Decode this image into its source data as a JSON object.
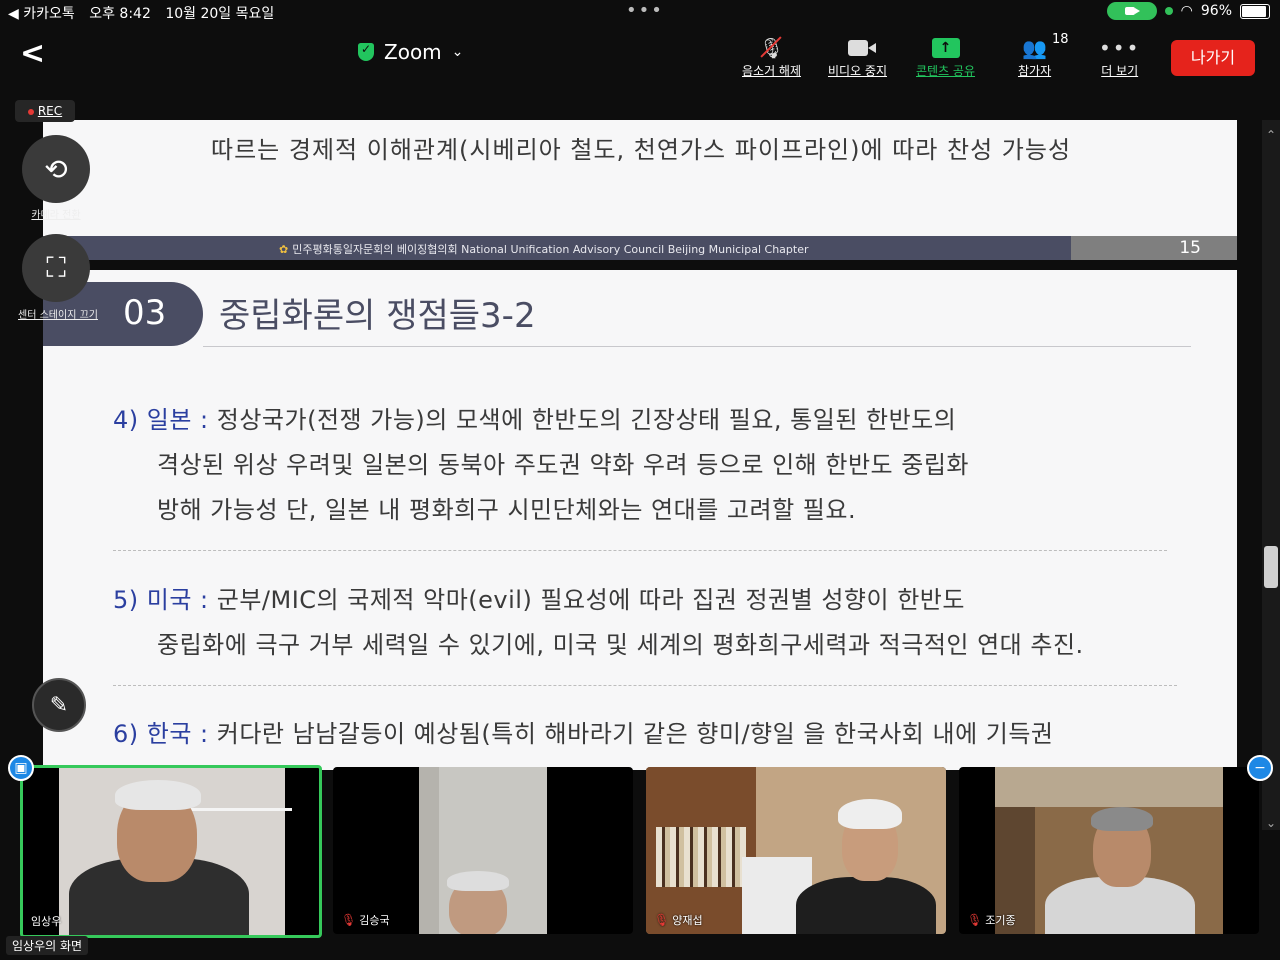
{
  "status": {
    "app": "◀ 카카오톡",
    "time": "오후 8:42",
    "date": "10월 20일 목요일",
    "battery": "96%"
  },
  "topbar": {
    "title": "Zoom",
    "mute_label": "음소거 해제",
    "video_label": "비디오 중지",
    "share_label": "콘텐츠 공유",
    "participants_label": "참가자",
    "participants_count": "18",
    "more_label": "더 보기",
    "leave_label": "나가기"
  },
  "side": {
    "rec": "REC",
    "camera_switch": "카메라 전환",
    "center_stage": "센터 스테이지 끄기"
  },
  "slide": {
    "top_text": "따르는 경제적 이해관계(시베리아 철도, 천연가스 파이프라인)에 따라 찬성 가능성",
    "footer": "민주평화통일자문회의 베이징협의회 National Unification Advisory Council Beijing Municipal Chapter",
    "page_number": "15",
    "section_number": "03",
    "section_title": "중립화론의 쟁점들3-2",
    "items": [
      {
        "label": "4) 일본 :",
        "line1": " 정상국가(전쟁 가능)의 모색에 한반도의 긴장상태 필요, 통일된 한반도의",
        "line2": "격상된 위상 우려및 일본의 동북아 주도권 약화 우려 등으로 인해 한반도 중립화",
        "line3": "방해 가능성 단, 일본 내 평화희구 시민단체와는 연대를 고려할 필요."
      },
      {
        "label": "5) 미국 :",
        "line1": " 군부/MIC의 국제적 악마(evil) 필요성에 따라 집권 정권별 성향이 한반도",
        "line2": "중립화에 극구 거부 세력일 수 있기에, 미국 및 세계의 평화희구세력과 적극적인 연대 추진."
      },
      {
        "label": "6) 한국 :",
        "line1": " 커다란 남남갈등이 예상됨(특히 해바라기 같은 향미/향일 을 한국사회 내에 기득권"
      }
    ]
  },
  "participants": [
    {
      "name": "임상우",
      "muted": false
    },
    {
      "name": "김승국",
      "muted": true
    },
    {
      "name": "양재섭",
      "muted": true
    },
    {
      "name": "조기종",
      "muted": true
    }
  ],
  "screen_owner": "임상우의 화면"
}
